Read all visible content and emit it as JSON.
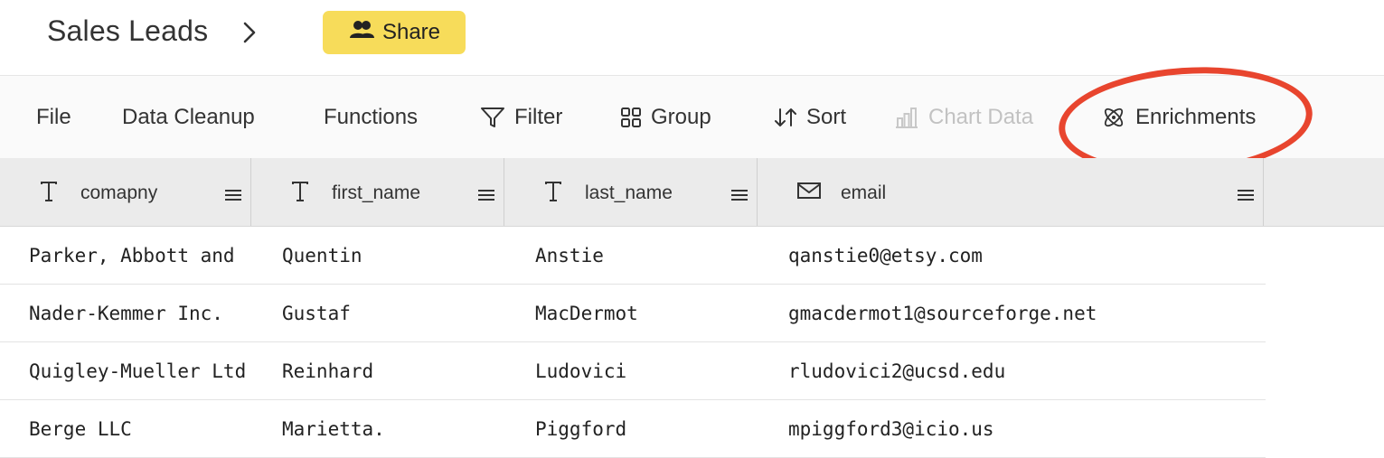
{
  "header": {
    "title": "Sales Leads",
    "share_label": "Share"
  },
  "toolbar": {
    "items": [
      {
        "label": "File",
        "icon": "none"
      },
      {
        "label": "Data Cleanup",
        "icon": "none"
      },
      {
        "label": "Functions",
        "icon": "none"
      },
      {
        "label": "Filter",
        "icon": "filter-icon"
      },
      {
        "label": "Group",
        "icon": "grid-icon"
      },
      {
        "label": "Sort",
        "icon": "sort-arrows-icon"
      },
      {
        "label": "Chart Data",
        "icon": "bar-chart-icon",
        "disabled": true
      },
      {
        "label": "Enrichments",
        "icon": "atom-icon",
        "highlighted": true
      }
    ]
  },
  "table": {
    "columns": [
      {
        "name": "comapny",
        "type_icon": "text-type-icon"
      },
      {
        "name": "first_name",
        "type_icon": "text-type-icon"
      },
      {
        "name": "last_name",
        "type_icon": "text-type-icon"
      },
      {
        "name": "email",
        "type_icon": "mail-icon"
      }
    ],
    "rows": [
      [
        "Parker, Abbott and",
        "Quentin",
        "Anstie",
        "qanstie0@etsy.com"
      ],
      [
        "Nader-Kemmer Inc.",
        "Gustaf",
        "MacDermot",
        "gmacdermot1@sourceforge.net"
      ],
      [
        "Quigley-Mueller Ltd",
        "Reinhard",
        "Ludovici",
        "rludovici2@ucsd.edu"
      ],
      [
        "Berge LLC",
        "Marietta.",
        "Piggford",
        "mpiggford3@icio.us"
      ]
    ]
  },
  "colors": {
    "share_bg": "#f7dc5a",
    "highlight_ring": "#e8452e",
    "disabled_text": "#c2c2c2"
  }
}
